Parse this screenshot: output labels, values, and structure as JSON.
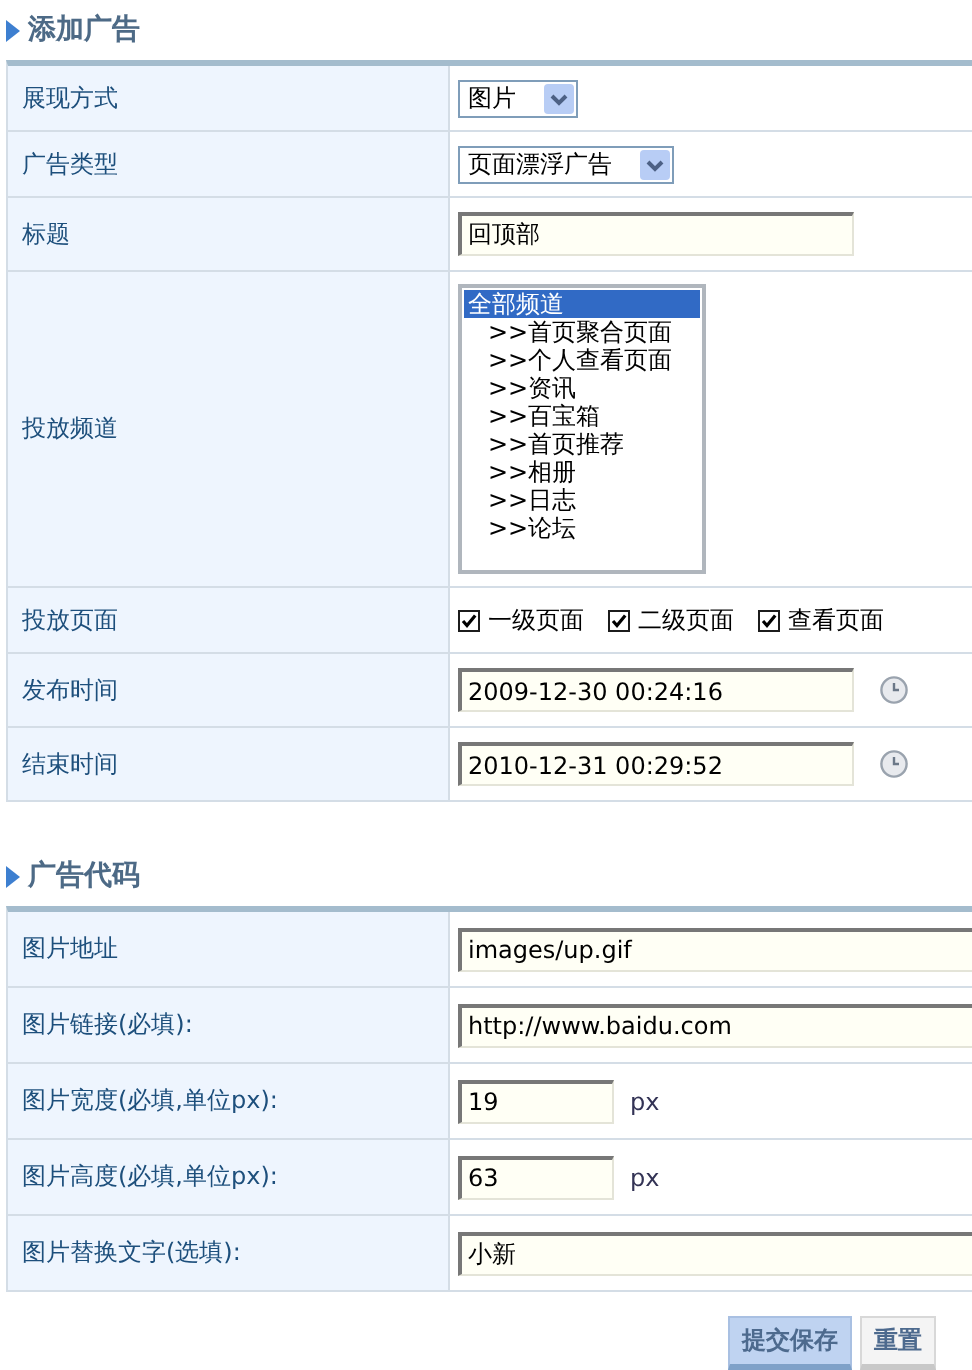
{
  "sections": [
    {
      "title": "添加广告",
      "rows": [
        {
          "kind": "select",
          "label": "展现方式",
          "value": "图片"
        },
        {
          "kind": "select",
          "label": "广告类型",
          "value": "页面漂浮广告"
        },
        {
          "kind": "text",
          "label": "标题",
          "value": "回顶部"
        },
        {
          "kind": "listbox",
          "label": "投放频道",
          "options": [
            {
              "text": "全部频道",
              "selected": true,
              "children": [
                {
                  "text": ">>首页聚合页面",
                  "selected": false
                },
                {
                  "text": ">>个人查看页面",
                  "selected": false
                },
                {
                  "text": ">>资讯",
                  "selected": false
                },
                {
                  "text": ">>百宝箱",
                  "selected": false
                },
                {
                  "text": ">>首页推荐",
                  "selected": false
                },
                {
                  "text": ">>相册",
                  "selected": false
                },
                {
                  "text": ">>日志",
                  "selected": false
                },
                {
                  "text": ">>论坛",
                  "selected": false
                }
              ]
            }
          ]
        },
        {
          "kind": "checkboxes",
          "label": "投放页面",
          "options": [
            {
              "text": "一级页面",
              "checked": true
            },
            {
              "text": "二级页面",
              "checked": true
            },
            {
              "text": "查看页面",
              "checked": true
            }
          ]
        },
        {
          "kind": "datetime",
          "label": "发布时间",
          "value": "2009-12-30 00:24:16"
        },
        {
          "kind": "datetime",
          "label": "结束时间",
          "value": "2010-12-31 00:29:52"
        }
      ]
    },
    {
      "title": "广告代码",
      "rows": [
        {
          "kind": "wide_text",
          "label": "图片地址",
          "value": "images/up.gif"
        },
        {
          "kind": "wide_text",
          "label": "图片链接(必填):",
          "value": "http://www.baidu.com"
        },
        {
          "kind": "number_unit",
          "label": "图片宽度(必填,单位px):",
          "value": "19",
          "unit": "px"
        },
        {
          "kind": "number_unit",
          "label": "图片高度(必填,单位px):",
          "value": "63",
          "unit": "px"
        },
        {
          "kind": "wide_text",
          "label": "图片替换文字(选填):",
          "value": "小新"
        }
      ]
    }
  ],
  "buttons": [
    {
      "label": "提交保存",
      "primary": true
    },
    {
      "label": "重置",
      "primary": false
    }
  ]
}
